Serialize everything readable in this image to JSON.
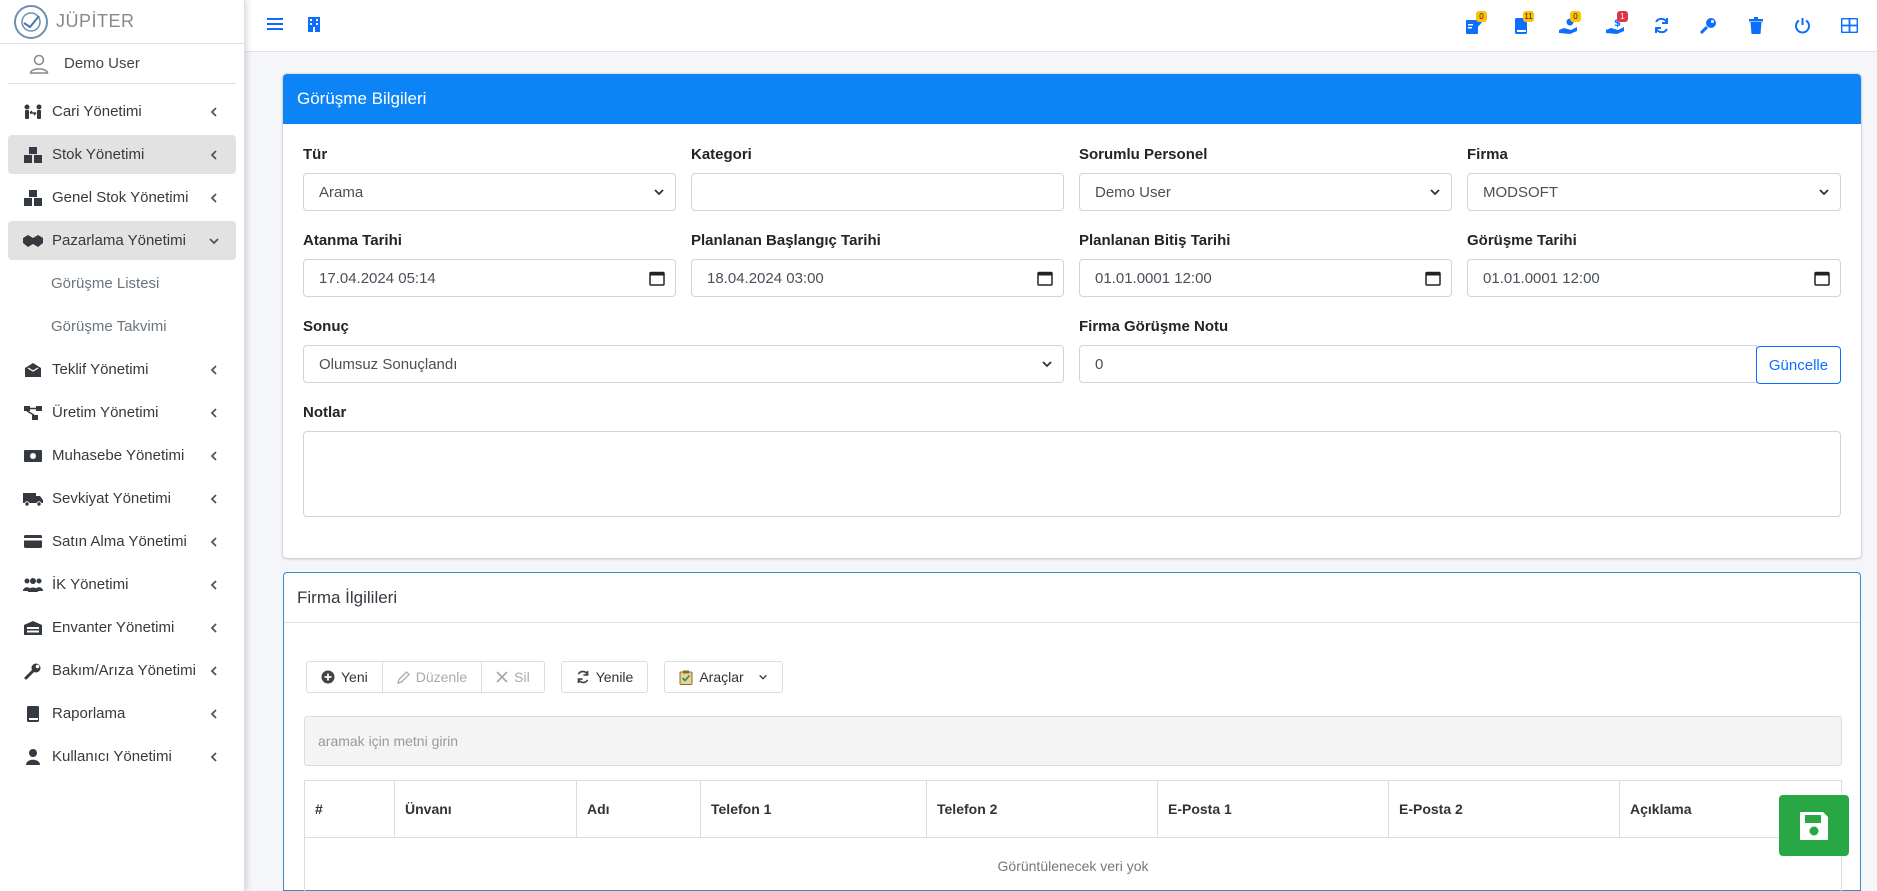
{
  "brand": {
    "name": "JÜPİTER"
  },
  "user": {
    "name": "Demo User"
  },
  "sidebar": {
    "items": [
      {
        "label": "Cari Yönetimi"
      },
      {
        "label": "Stok Yönetimi"
      },
      {
        "label": "Genel Stok Yönetimi"
      },
      {
        "label": "Pazarlama Yönetimi"
      },
      {
        "label": "Teklif Yönetimi"
      },
      {
        "label": "Üretim Yönetimi"
      },
      {
        "label": "Muhasebe Yönetimi"
      },
      {
        "label": "Sevkiyat Yönetimi"
      },
      {
        "label": "Satın Alma Yönetimi"
      },
      {
        "label": "İK Yönetimi"
      },
      {
        "label": "Envanter Yönetimi"
      },
      {
        "label": "Bakım/Arıza Yönetimi"
      },
      {
        "label": "Raporlama"
      },
      {
        "label": "Kullanıcı Yönetimi"
      }
    ],
    "subitems": [
      {
        "label": "Görüşme Listesi"
      },
      {
        "label": "Görüşme Takvimi"
      }
    ]
  },
  "topbar": {
    "badges": [
      "0",
      "11",
      "0",
      "1"
    ],
    "badge_colors": [
      "#ffc107",
      "#ffc107",
      "#ffc107",
      "#dc3545"
    ]
  },
  "form": {
    "title": "Görüşme Bilgileri",
    "tur": {
      "label": "Tür",
      "value": "Arama"
    },
    "kategori": {
      "label": "Kategori",
      "value": ""
    },
    "personel": {
      "label": "Sorumlu Personel",
      "value": "Demo User"
    },
    "firma": {
      "label": "Firma",
      "value": "MODSOFT"
    },
    "atanma": {
      "label": "Atanma Tarihi",
      "value": "17.04.2024 05:14"
    },
    "baslangic": {
      "label": "Planlanan Başlangıç Tarihi",
      "value": "18.04.2024 03:00"
    },
    "bitis": {
      "label": "Planlanan Bitiş Tarihi",
      "value": "01.01.0001 12:00"
    },
    "gorusme": {
      "label": "Görüşme Tarihi",
      "value": "01.01.0001 12:00"
    },
    "sonuc": {
      "label": "Sonuç",
      "value": "Olumsuz Sonuçlandı"
    },
    "not": {
      "label": "Firma Görüşme Notu",
      "value": "0",
      "button": "Güncelle"
    },
    "notlar": {
      "label": "Notlar",
      "value": ""
    }
  },
  "contacts": {
    "title": "Firma İlgilileri",
    "toolbar": {
      "new": "Yeni",
      "edit": "Düzenle",
      "delete": "Sil",
      "refresh": "Yenile",
      "tools": "Araçlar"
    },
    "search_placeholder": "aramak için metni girin",
    "columns": [
      "#",
      "Ünvanı",
      "Adı",
      "Telefon 1",
      "Telefon 2",
      "E-Posta 1",
      "E-Posta 2",
      "Açıklama"
    ],
    "empty_text": "Görüntülenecek veri yok"
  },
  "colors": {
    "primary": "#0d84f5",
    "save": "#28a745"
  }
}
